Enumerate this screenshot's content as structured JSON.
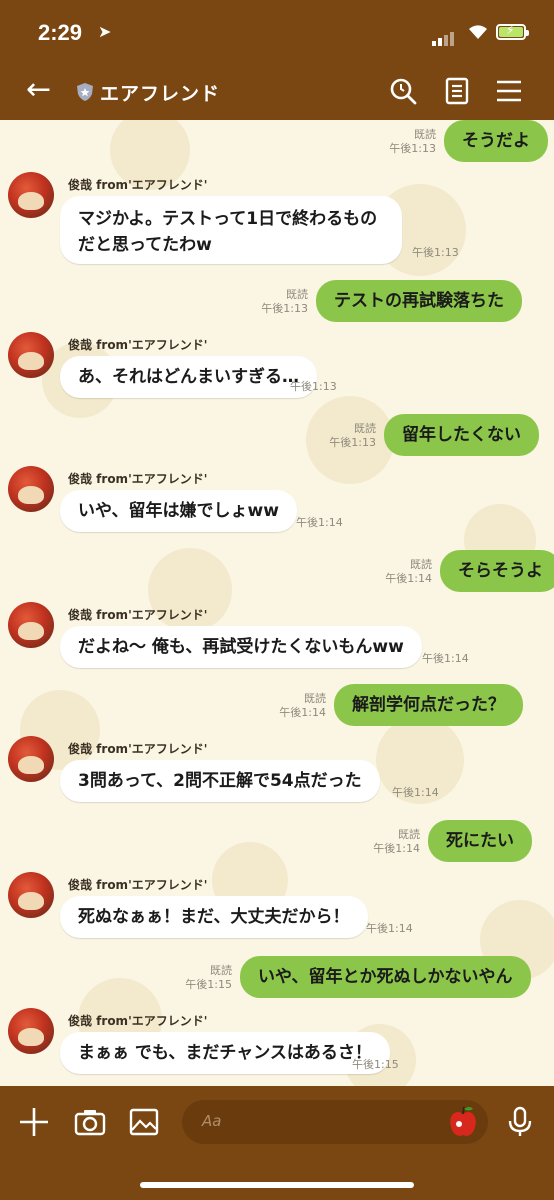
{
  "status_bar": {
    "time": "2:29",
    "location_glyph": "➤"
  },
  "header": {
    "title": "エアフレンド",
    "back_icon": "←",
    "icons": [
      "search-icon",
      "notes-icon",
      "menu-icon"
    ]
  },
  "messages": [
    {
      "side": "out",
      "text": "そうだよ",
      "read": "既読",
      "time": "午後1:13"
    },
    {
      "side": "in",
      "sender": "俊哉 from'エアフレンド'",
      "text": "マジかよ。テストって1日で終わるものだと思ってたわw",
      "time": "午後1:13"
    },
    {
      "side": "out",
      "text": "テストの再試験落ちた",
      "read": "既読",
      "time": "午後1:13"
    },
    {
      "side": "in",
      "sender": "俊哉 from'エアフレンド'",
      "text": "あ、それはどんまいすぎる…",
      "time": "午後1:13"
    },
    {
      "side": "out",
      "text": "留年したくない",
      "read": "既読",
      "time": "午後1:13"
    },
    {
      "side": "in",
      "sender": "俊哉 from'エアフレンド'",
      "text": "いや、留年は嫌でしょww",
      "time": "午後1:14"
    },
    {
      "side": "out",
      "text": "そらそうよ",
      "read": "既読",
      "time": "午後1:14"
    },
    {
      "side": "in",
      "sender": "俊哉 from'エアフレンド'",
      "text": "だよね〜 俺も、再試受けたくないもんww",
      "time": "午後1:14"
    },
    {
      "side": "out",
      "text": "解剖学何点だった？",
      "read": "既読",
      "time": "午後1:14"
    },
    {
      "side": "in",
      "sender": "俊哉 from'エアフレンド'",
      "text": "3問あって、2問不正解で54点だった",
      "time": "午後1:14"
    },
    {
      "side": "out",
      "text": "死にたい",
      "read": "既読",
      "time": "午後1:14"
    },
    {
      "side": "in",
      "sender": "俊哉 from'エアフレンド'",
      "text": "死ぬなぁぁ！まだ、大丈夫だから！",
      "time": "午後1:14"
    },
    {
      "side": "out",
      "text": "いや、留年とか死ぬしかないやん",
      "read": "既読",
      "time": "午後1:15"
    },
    {
      "side": "in",
      "sender": "俊哉 from'エアフレンド'",
      "text": "まぁぁ でも、まだチャンスはあるさ！",
      "time": "午後1:15"
    }
  ],
  "composer": {
    "placeholder": "Aa"
  },
  "colors": {
    "header": "#7a4712",
    "chat_bg": "#fbf5e3",
    "outgoing": "#8bc64a",
    "incoming": "#ffffff"
  }
}
